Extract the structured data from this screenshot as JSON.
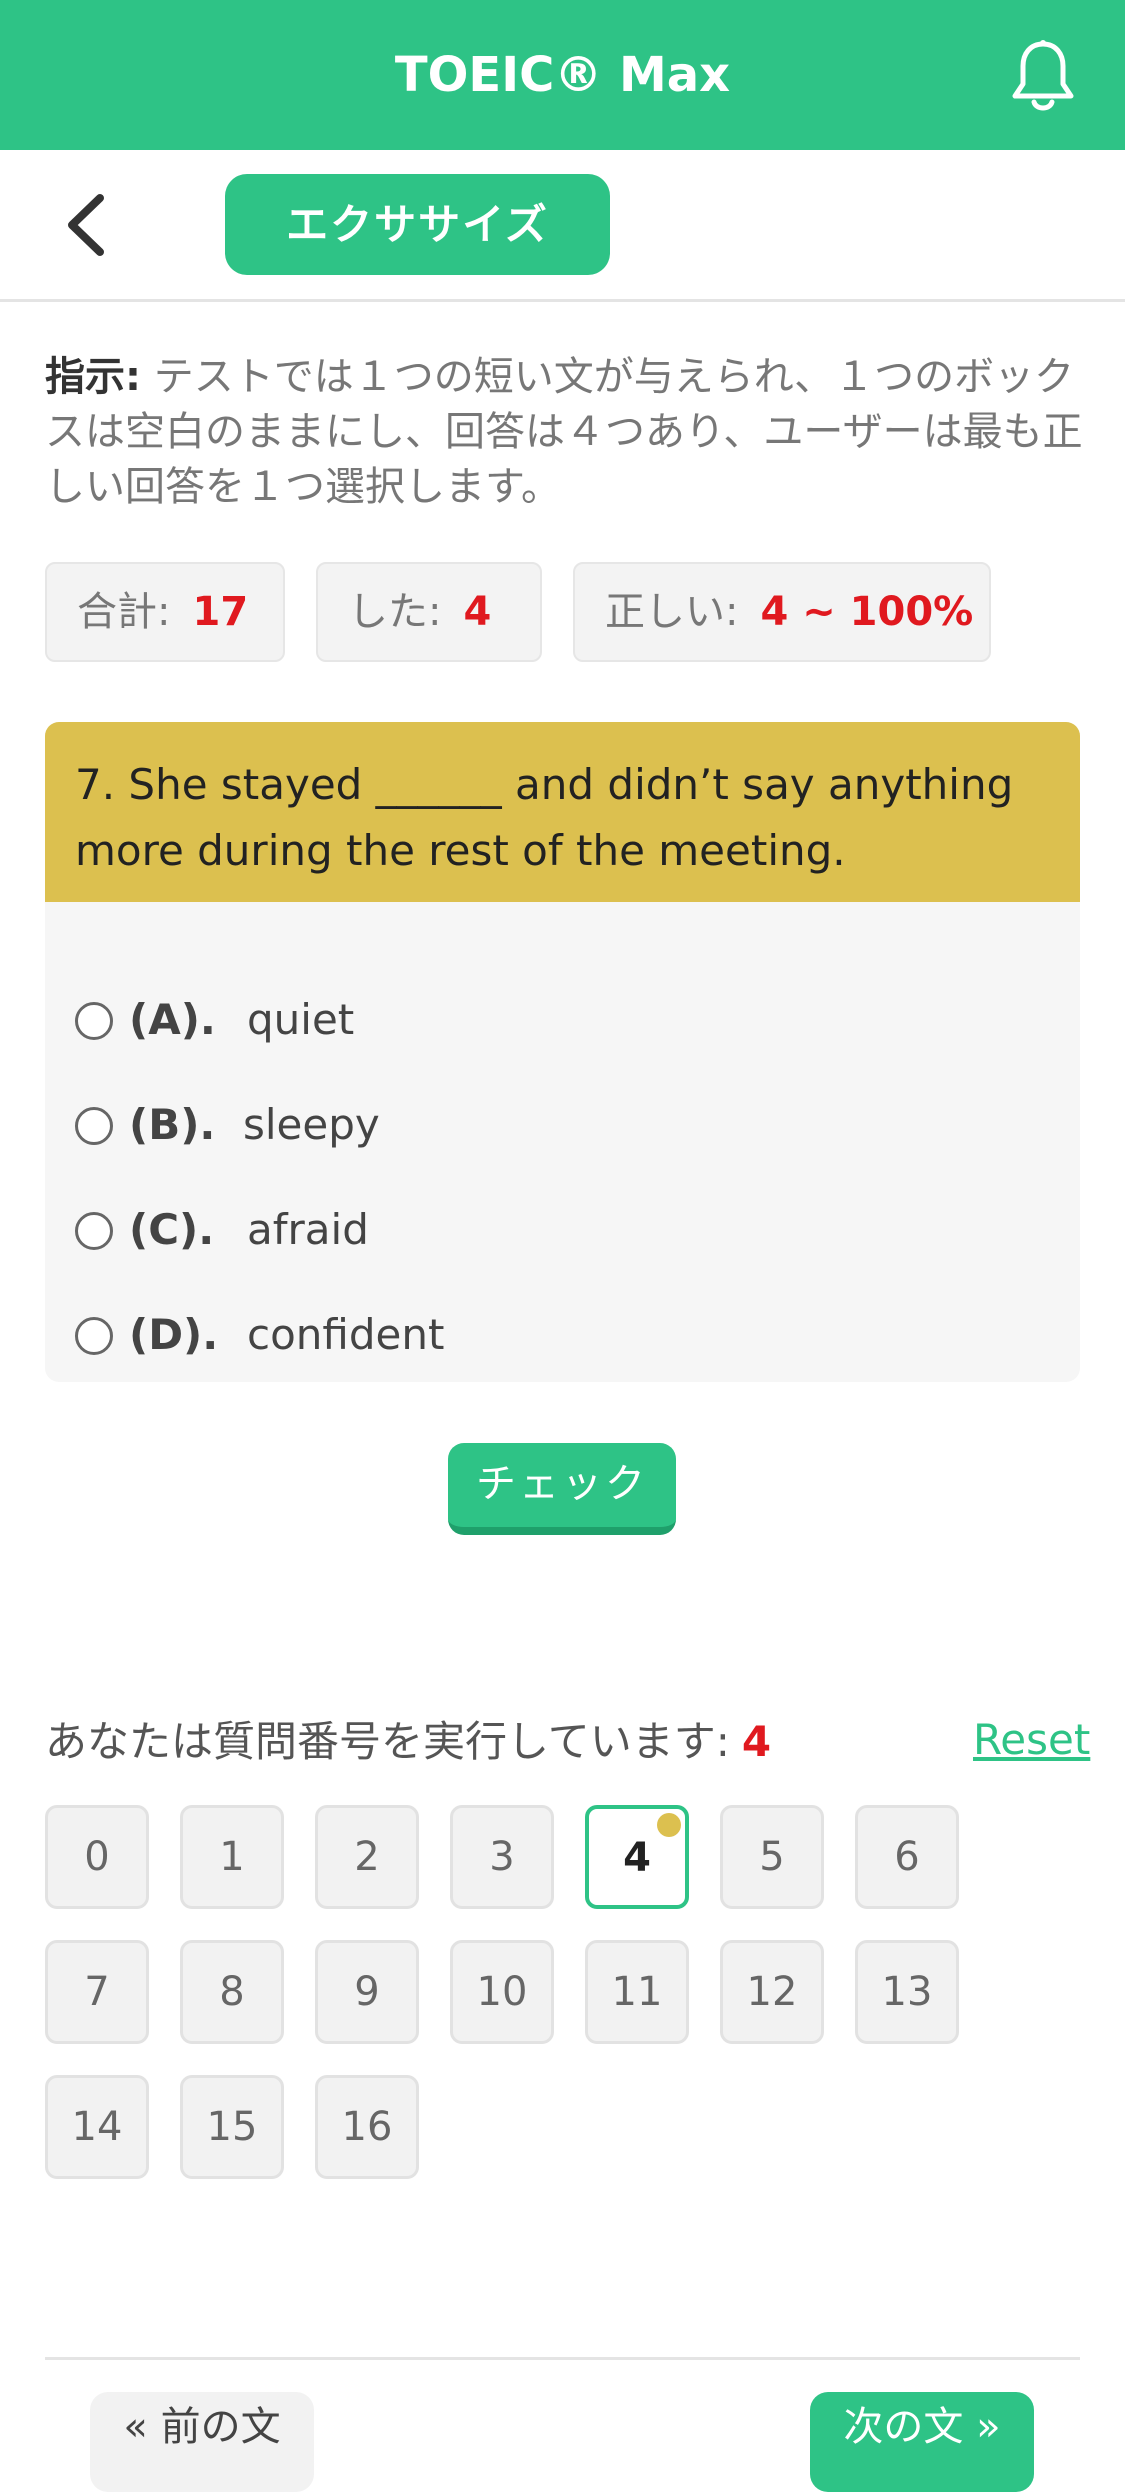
{
  "header": {
    "title": "TOEIC® Max",
    "notification_icon": "bell-icon"
  },
  "subnav": {
    "back_icon": "chevron-left-icon",
    "tab_label": "エクササイズ"
  },
  "instruction": {
    "label": "指示:",
    "text": " テストでは１つの短い文が与えられ、１つのボックスは空白のままにし、回答は４つあり、ユーザーは最も正しい回答を１つ選択します。"
  },
  "stats": {
    "total_label": "合計:",
    "total_value": "17",
    "done_label": "した:",
    "done_value": "4",
    "correct_label": "正しい:",
    "correct_value": "4 ~ 100%"
  },
  "question": {
    "text": "7. She stayed ______ and didn’t say anything more during the rest of the meeting.",
    "options": [
      {
        "letter": "(A).",
        "text": "quiet"
      },
      {
        "letter": "(B).",
        "text": "sleepy"
      },
      {
        "letter": "(C).",
        "text": "afraid"
      },
      {
        "letter": "(D).",
        "text": "confident"
      }
    ]
  },
  "check_button": "チェック",
  "progress": {
    "label": "あなたは質問番号を実行しています:",
    "current": "4",
    "reset_label": "Reset",
    "numbers": [
      "0",
      "1",
      "2",
      "3",
      "4",
      "5",
      "6",
      "7",
      "8",
      "9",
      "10",
      "11",
      "12",
      "13",
      "14",
      "15",
      "16"
    ]
  },
  "footer": {
    "prev_label": "« 前の文",
    "next_label": "次の文 »"
  },
  "colors": {
    "brand_green": "#2ec386",
    "question_yellow": "#dcc04f",
    "highlight_red": "#e0191f"
  }
}
